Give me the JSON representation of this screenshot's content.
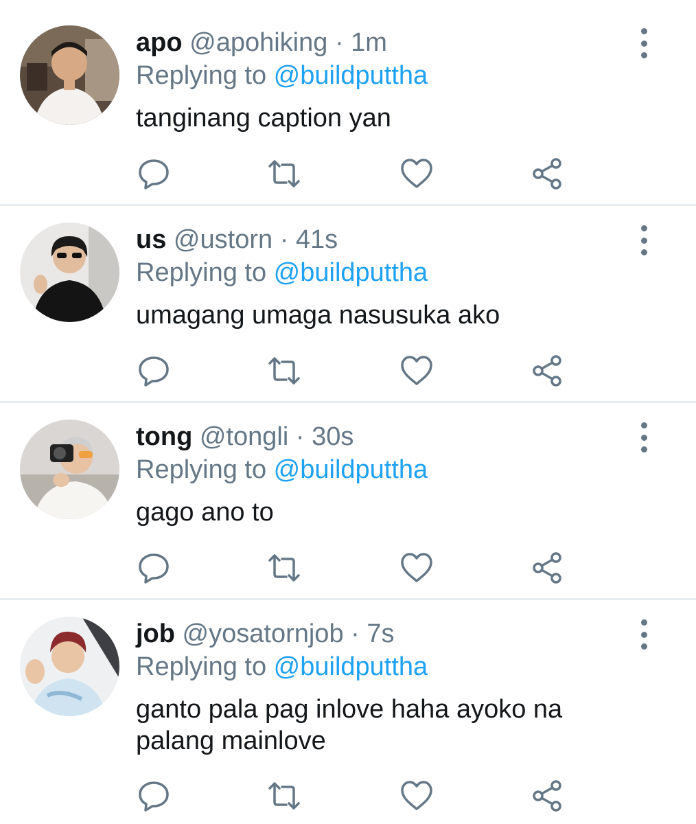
{
  "tweets": [
    {
      "name": "apo",
      "handle": "@apohiking",
      "separator": "·",
      "time": "1m",
      "replying_prefix": "Replying to ",
      "replying_to": "@buildputtha",
      "text": "tanginang caption yan"
    },
    {
      "name": "us",
      "handle": "@ustorn",
      "separator": "·",
      "time": "41s",
      "replying_prefix": "Replying to ",
      "replying_to": "@buildputtha",
      "text": "umagang umaga nasusuka ako"
    },
    {
      "name": "tong",
      "handle": "@tongli",
      "separator": "·",
      "time": "30s",
      "replying_prefix": "Replying to ",
      "replying_to": "@buildputtha",
      "text": "gago ano to"
    },
    {
      "name": "job",
      "handle": "@yosatornjob",
      "separator": "·",
      "time": "7s",
      "replying_prefix": "Replying to ",
      "replying_to": "@buildputtha",
      "text": "ganto pala pag inlove haha ayoko na palang mainlove"
    }
  ],
  "icons": {
    "reply": "speech-bubble-icon",
    "retweet": "retweet-arrows-icon",
    "like": "heart-icon",
    "share": "share-nodes-icon",
    "more": "vertical-dots-icon"
  },
  "colors": {
    "text": "#14171a",
    "secondary": "#657786",
    "mention": "#1da1f2",
    "divider": "#e6ecf0"
  }
}
